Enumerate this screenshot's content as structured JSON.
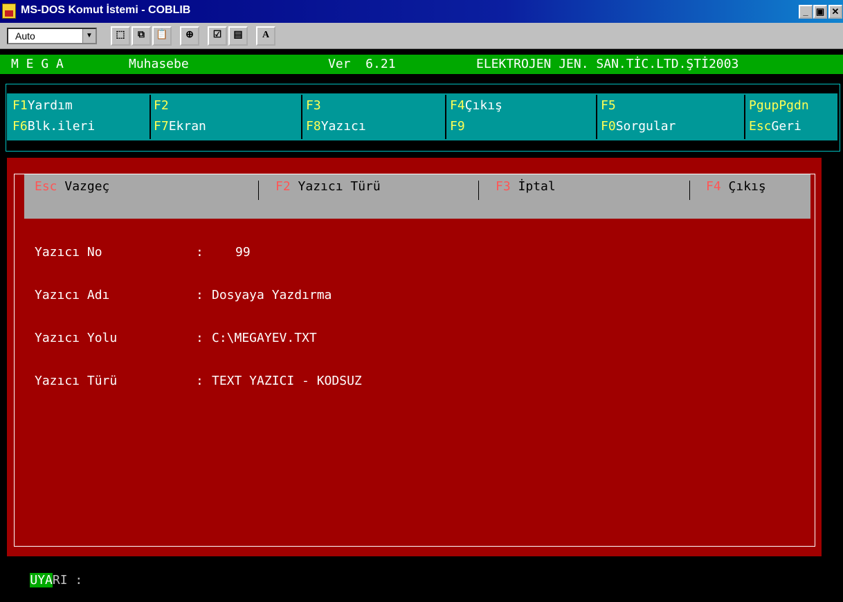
{
  "window": {
    "title": "MS-DOS Komut İstemi - COBLIB"
  },
  "toolbar": {
    "font_size": "Auto",
    "font_icon_label": "A"
  },
  "header": {
    "app": "M E G A",
    "module": "Muhasebe",
    "version": "Ver  6.21",
    "company": "ELEKTROJEN JEN. SAN.TİC.LTD.ŞTİ2003"
  },
  "menu": {
    "row1": [
      {
        "key": "F1",
        "label": "Yardım"
      },
      {
        "key": "F2",
        "label": ""
      },
      {
        "key": "F3",
        "label": ""
      },
      {
        "key": "F4",
        "label": "Çıkış"
      },
      {
        "key": "F5",
        "label": ""
      },
      {
        "key": "",
        "label": "PgupPgdn"
      }
    ],
    "row2": [
      {
        "key": "F6",
        "label": "Blk.ileri"
      },
      {
        "key": "F7",
        "label": "Ekran"
      },
      {
        "key": "F8",
        "label": "Yazıcı"
      },
      {
        "key": "F9",
        "label": ""
      },
      {
        "key": "F0",
        "label": "Sorgular"
      },
      {
        "key": "Esc",
        "label": "Geri"
      }
    ]
  },
  "commands": [
    {
      "key": "Esc",
      "label": " Vazgeç"
    },
    {
      "key": "F2",
      "label": " Yazıcı Türü"
    },
    {
      "key": "F3",
      "label": " İptal"
    },
    {
      "key": "F4",
      "label": " Çıkış"
    }
  ],
  "fields": [
    {
      "label": "Yazıcı No",
      "sep": ":",
      "value": "99"
    },
    {
      "label": "Yazıcı Adı",
      "sep": ":",
      "value": "Dosyaya Yazdırma"
    },
    {
      "label": "Yazıcı Yolu",
      "sep": ":",
      "value": "C:\\MEGAYEV.TXT"
    },
    {
      "label": "Yazıcı Türü",
      "sep": ":",
      "value": "TEXT YAZICI - KODSUZ"
    }
  ],
  "status": {
    "prefix": "UYA",
    "rest": "RI :"
  },
  "colors": {
    "header_bg": "#00a800",
    "menu_bg": "#009898",
    "panel_bg": "#a00000",
    "cmdbar_bg": "#a8a8a8",
    "key_color": "#ffff55",
    "cmd_key_color": "#ff5555"
  }
}
